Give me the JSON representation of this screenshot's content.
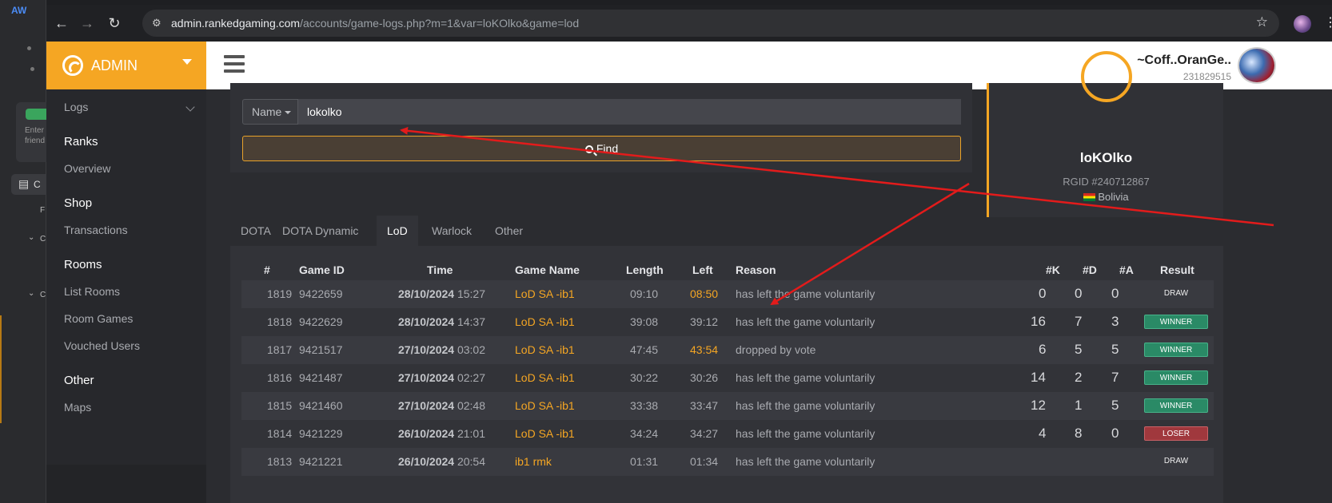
{
  "outer_app": {
    "label": "AW",
    "enter_text": "Enter",
    "friend_text": "friend",
    "c1": "C",
    "p": "F",
    "c2": "C",
    "c3": "C"
  },
  "browser": {
    "url_host": "admin.rankedgaming.com",
    "url_path": "/accounts/game-logs.php?m=1&var=loKOlko&game=lod"
  },
  "header": {
    "brand": "ADMIN",
    "user_name": "~Coff..OranGe..",
    "user_id": "231829515"
  },
  "sidebar": {
    "logs": "Logs",
    "ranks": "Ranks",
    "overview": "Overview",
    "shop": "Shop",
    "transactions": "Transactions",
    "rooms": "Rooms",
    "list_rooms": "List Rooms",
    "room_games": "Room Games",
    "vouched_users": "Vouched Users",
    "other": "Other",
    "maps": "Maps"
  },
  "search": {
    "field_select": "Name",
    "value": "lokolko",
    "button": "Find"
  },
  "profile": {
    "name": "loKOlko",
    "rgid": "RGID #240712867",
    "country": "Bolivia"
  },
  "tabs": [
    {
      "label": "DOTA",
      "active": false
    },
    {
      "label": "DOTA Dynamic",
      "active": false
    },
    {
      "label": "LoD",
      "active": true
    },
    {
      "label": "Warlock",
      "active": false
    },
    {
      "label": "Other",
      "active": false
    }
  ],
  "table": {
    "columns": [
      "#",
      "Game ID",
      "Time",
      "Game Name",
      "Length",
      "Left",
      "Reason",
      "#K",
      "#D",
      "#A",
      "Result"
    ],
    "rows": [
      {
        "n": "1819",
        "game_id": "9422659",
        "date": "28/10/2024",
        "time": "15:27",
        "game_name": "LoD SA -ib1",
        "length": "09:10",
        "left": "08:50",
        "left_hi": true,
        "reason": "has left the game voluntarily",
        "k": "0",
        "d": "0",
        "a": "0",
        "result": "DRAW"
      },
      {
        "n": "1818",
        "game_id": "9422629",
        "date": "28/10/2024",
        "time": "14:37",
        "game_name": "LoD SA -ib1",
        "length": "39:08",
        "left": "39:12",
        "left_hi": false,
        "reason": "has left the game voluntarily",
        "k": "16",
        "d": "7",
        "a": "3",
        "result": "WINNER"
      },
      {
        "n": "1817",
        "game_id": "9421517",
        "date": "27/10/2024",
        "time": "03:02",
        "game_name": "LoD SA -ib1",
        "length": "47:45",
        "left": "43:54",
        "left_hi": true,
        "reason": "dropped by vote",
        "k": "6",
        "d": "5",
        "a": "5",
        "result": "WINNER"
      },
      {
        "n": "1816",
        "game_id": "9421487",
        "date": "27/10/2024",
        "time": "02:27",
        "game_name": "LoD SA -ib1",
        "length": "30:22",
        "left": "30:26",
        "left_hi": false,
        "reason": "has left the game voluntarily",
        "k": "14",
        "d": "2",
        "a": "7",
        "result": "WINNER"
      },
      {
        "n": "1815",
        "game_id": "9421460",
        "date": "27/10/2024",
        "time": "02:48",
        "game_name": "LoD SA -ib1",
        "length": "33:38",
        "left": "33:47",
        "left_hi": false,
        "reason": "has left the game voluntarily",
        "k": "12",
        "d": "1",
        "a": "5",
        "result": "WINNER"
      },
      {
        "n": "1814",
        "game_id": "9421229",
        "date": "26/10/2024",
        "time": "21:01",
        "game_name": "LoD SA -ib1",
        "length": "34:24",
        "left": "34:27",
        "left_hi": false,
        "reason": "has left the game voluntarily",
        "k": "4",
        "d": "8",
        "a": "0",
        "result": "LOSER"
      },
      {
        "n": "1813",
        "game_id": "9421221",
        "date": "26/10/2024",
        "time": "20:54",
        "game_name": "ib1 rmk",
        "length": "01:31",
        "left": "01:34",
        "left_hi": false,
        "reason": "has left the game voluntarily",
        "k": "",
        "d": "",
        "a": "",
        "result": "DRAW"
      }
    ]
  },
  "colors": {
    "brand_orange": "#f5a623",
    "winner": "#2a8a66",
    "loser": "#a0383d",
    "annotation_arrow": "#e31b1b"
  }
}
